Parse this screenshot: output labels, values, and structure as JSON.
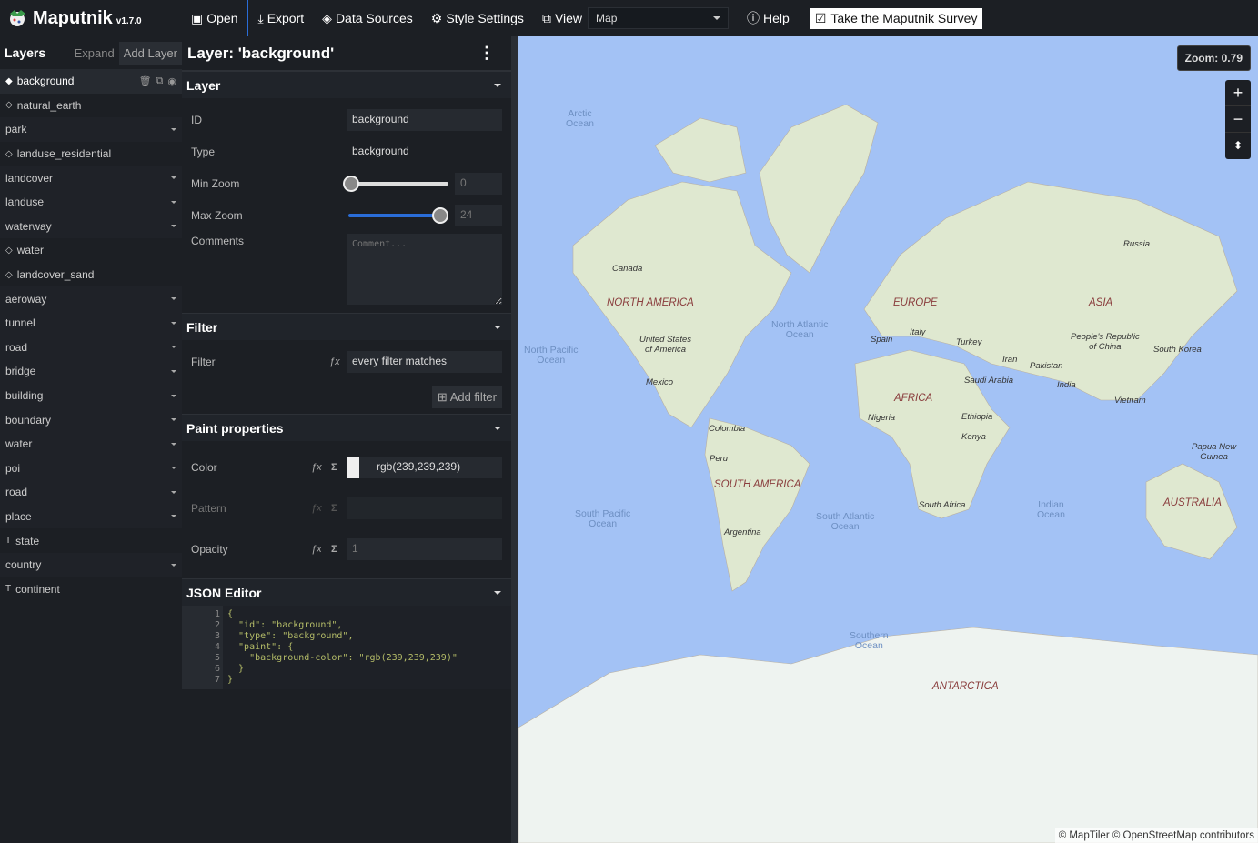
{
  "topbar": {
    "app_name": "Maputnik",
    "version": "v1.7.0",
    "open": "Open",
    "export": "Export",
    "data_sources": "Data Sources",
    "style_settings": "Style Settings",
    "view": "View",
    "view_select": "Map",
    "help": "Help",
    "survey": "Take the Maputnik Survey"
  },
  "layers": {
    "title": "Layers",
    "expand": "Expand",
    "add_layer": "Add Layer",
    "items": [
      {
        "label": "background",
        "kind": "layer",
        "icon": "background-icon"
      },
      {
        "label": "natural_earth",
        "kind": "layer",
        "icon": "raster-icon"
      },
      {
        "label": "park",
        "kind": "group"
      },
      {
        "label": "landuse_residential",
        "kind": "layer",
        "icon": "fill-icon"
      },
      {
        "label": "landcover",
        "kind": "group"
      },
      {
        "label": "landuse",
        "kind": "group"
      },
      {
        "label": "waterway",
        "kind": "group"
      },
      {
        "label": "water",
        "kind": "layer",
        "icon": "fill-icon"
      },
      {
        "label": "landcover_sand",
        "kind": "layer",
        "icon": "fill-icon"
      },
      {
        "label": "aeroway",
        "kind": "group"
      },
      {
        "label": "tunnel",
        "kind": "group"
      },
      {
        "label": "road",
        "kind": "group"
      },
      {
        "label": "bridge",
        "kind": "group"
      },
      {
        "label": "building",
        "kind": "group"
      },
      {
        "label": "boundary",
        "kind": "group"
      },
      {
        "label": "water",
        "kind": "group"
      },
      {
        "label": "poi",
        "kind": "group"
      },
      {
        "label": "road",
        "kind": "group"
      },
      {
        "label": "place",
        "kind": "group"
      },
      {
        "label": "state",
        "kind": "layer",
        "icon": "symbol-icon"
      },
      {
        "label": "country",
        "kind": "group"
      },
      {
        "label": "continent",
        "kind": "layer",
        "icon": "symbol-icon"
      }
    ]
  },
  "editor": {
    "title": "Layer: 'background'",
    "layer_section": {
      "title": "Layer",
      "id_label": "ID",
      "id_value": "background",
      "type_label": "Type",
      "type_value": "background",
      "minzoom_label": "Min Zoom",
      "minzoom_value": "0",
      "maxzoom_label": "Max Zoom",
      "maxzoom_value": "24",
      "comments_label": "Comments",
      "comments_placeholder": "Comment..."
    },
    "filter_section": {
      "title": "Filter",
      "filter_label": "Filter",
      "filter_select": "every filter matches",
      "add_filter": "Add filter"
    },
    "paint_section": {
      "title": "Paint properties",
      "color_label": "Color",
      "color_value": "rgb(239,239,239)",
      "pattern_label": "Pattern",
      "opacity_label": "Opacity",
      "opacity_value": "1"
    },
    "json_section": {
      "title": "JSON Editor",
      "line_numbers": "1\n2\n3\n4\n5\n6\n7",
      "code": "{\n  \"id\": \"background\",\n  \"type\": \"background\",\n  \"paint\": {\n    \"background-color\": \"rgb(239,239,239)\"\n  }\n}"
    }
  },
  "map": {
    "zoom_label": "Zoom: 0.79",
    "zoom_value": 0.79,
    "attribution": "© MapTiler © OpenStreetMap contributors",
    "water_color": "#a3c2f5",
    "land_color": "#dfe8d0",
    "labels": [
      {
        "t": "Arctic\nOcean",
        "c": "ocean"
      },
      {
        "t": "Canada",
        "c": "ctry"
      },
      {
        "t": "NORTH AMERICA",
        "c": "cont"
      },
      {
        "t": "United States\nof America",
        "c": "ctry"
      },
      {
        "t": "North Pacific\nOcean",
        "c": "ocean"
      },
      {
        "t": "North Atlantic\nOcean",
        "c": "ocean"
      },
      {
        "t": "Mexico",
        "c": "ctry"
      },
      {
        "t": "Colombia",
        "c": "ctry"
      },
      {
        "t": "Peru",
        "c": "ctry"
      },
      {
        "t": "SOUTH AMERICA",
        "c": "cont"
      },
      {
        "t": "Argentina",
        "c": "ctry"
      },
      {
        "t": "South Pacific\nOcean",
        "c": "ocean"
      },
      {
        "t": "South Atlantic\nOcean",
        "c": "ocean"
      },
      {
        "t": "EUROPE",
        "c": "cont"
      },
      {
        "t": "Spain",
        "c": "ctry"
      },
      {
        "t": "Italy",
        "c": "ctry"
      },
      {
        "t": "Turkey",
        "c": "ctry"
      },
      {
        "t": "AFRICA",
        "c": "cont"
      },
      {
        "t": "Nigeria",
        "c": "ctry"
      },
      {
        "t": "Ethiopia",
        "c": "ctry"
      },
      {
        "t": "Kenya",
        "c": "ctry"
      },
      {
        "t": "South Africa",
        "c": "ctry"
      },
      {
        "t": "Saudi Arabia",
        "c": "ctry"
      },
      {
        "t": "Iran",
        "c": "ctry"
      },
      {
        "t": "Pakistan",
        "c": "ctry"
      },
      {
        "t": "India",
        "c": "ctry"
      },
      {
        "t": "ASIA",
        "c": "cont"
      },
      {
        "t": "Russia",
        "c": "ctry"
      },
      {
        "t": "People's Republic\nof China",
        "c": "ctry"
      },
      {
        "t": "South Korea",
        "c": "ctry"
      },
      {
        "t": "Vietnam",
        "c": "ctry"
      },
      {
        "t": "Papua New\nGuinea",
        "c": "ctry"
      },
      {
        "t": "AUSTRALIA",
        "c": "cont"
      },
      {
        "t": "Indian\nOcean",
        "c": "ocean"
      },
      {
        "t": "Southern\nOcean",
        "c": "ocean"
      },
      {
        "t": "ANTARCTICA",
        "c": "cont"
      }
    ]
  }
}
